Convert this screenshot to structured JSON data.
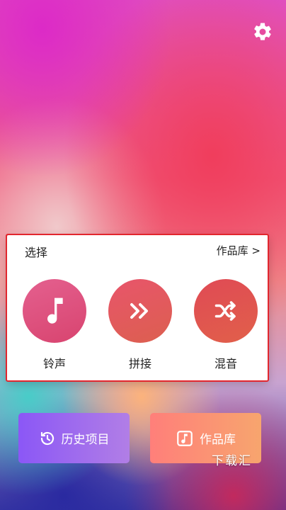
{
  "card": {
    "title": "选择",
    "link": "作品库 >",
    "actions": [
      {
        "label": "铃声",
        "icon": "music-note-icon",
        "color": "#dc4f7c"
      },
      {
        "label": "拼接",
        "icon": "fast-forward-icon",
        "color": "#e2575d"
      },
      {
        "label": "混音",
        "icon": "shuffle-icon",
        "color": "#e0524a"
      }
    ]
  },
  "bottom": {
    "history_label": "历史项目",
    "works_label": "作品库"
  },
  "watermark": "下载汇",
  "colors": {
    "highlight_border": "#e2262e",
    "history_gradient": [
      "#8b57f6",
      "#b17ee6"
    ],
    "works_gradient": [
      "#ff7f7a",
      "#f7a56e"
    ]
  }
}
